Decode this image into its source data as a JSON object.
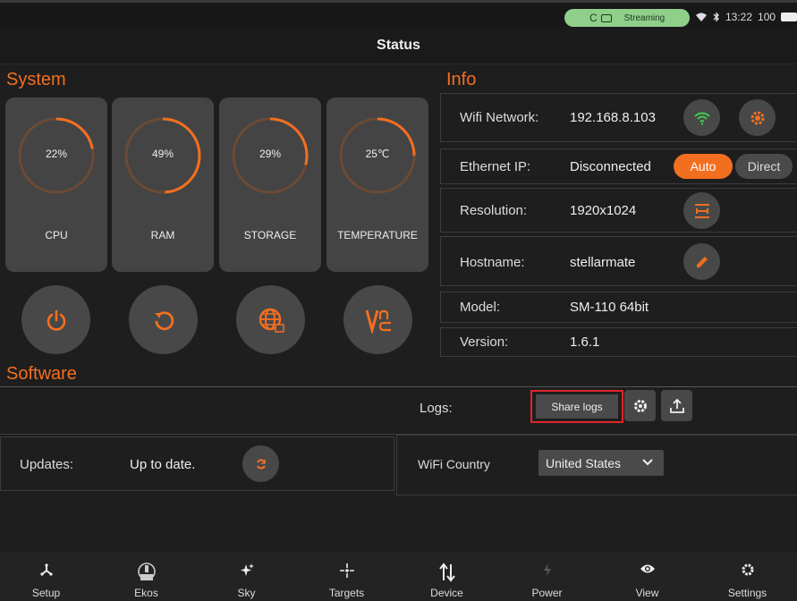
{
  "statusbar": {
    "streaming_label": "Streaming",
    "c_label": "C",
    "time": "13:22",
    "battery": "100"
  },
  "title": "Status",
  "sections": {
    "system": "System",
    "info": "Info",
    "software": "Software"
  },
  "gauges": [
    {
      "label": "CPU",
      "value_text": "22%",
      "value": 22
    },
    {
      "label": "RAM",
      "value_text": "49%",
      "value": 49
    },
    {
      "label": "STORAGE",
      "value_text": "29%",
      "value": 29
    },
    {
      "label": "TEMPERATURE",
      "value_text": "25℃",
      "value": 25
    }
  ],
  "actions": [
    "power-icon",
    "restart-icon",
    "web-icon",
    "vnc-icon"
  ],
  "info": {
    "wifi": {
      "label": "Wifi Network:",
      "value": "192.168.8.103"
    },
    "ethernet": {
      "label": "Ethernet IP:",
      "value": "Disconnected",
      "auto": "Auto",
      "direct": "Direct"
    },
    "resolution": {
      "label": "Resolution:",
      "value": "1920x1024"
    },
    "hostname": {
      "label": "Hostname:",
      "value": "stellarmate"
    },
    "model": {
      "label": "Model:",
      "value": "SM-110 64bit"
    },
    "version": {
      "label": "Version:",
      "value": "1.6.1"
    }
  },
  "software": {
    "logs_label": "Logs:",
    "share_logs": "Share logs",
    "updates_label": "Updates:",
    "updates_value": "Up to date.",
    "wifi_country_label": "WiFi Country",
    "wifi_country_value": "United States"
  },
  "nav": [
    {
      "label": "Setup",
      "icon": "setup-icon"
    },
    {
      "label": "Ekos",
      "icon": "ekos-icon"
    },
    {
      "label": "Sky",
      "icon": "sky-icon"
    },
    {
      "label": "Targets",
      "icon": "targets-icon"
    },
    {
      "label": "Device",
      "icon": "device-icon"
    },
    {
      "label": "Power",
      "icon": "power-icon"
    },
    {
      "label": "View",
      "icon": "view-icon"
    },
    {
      "label": "Settings",
      "icon": "settings-icon"
    }
  ],
  "colors": {
    "accent": "#f36f20",
    "streaming": "#8fcf8a",
    "wifi_green": "#3ccf4e",
    "highlight": "#e0252b"
  }
}
